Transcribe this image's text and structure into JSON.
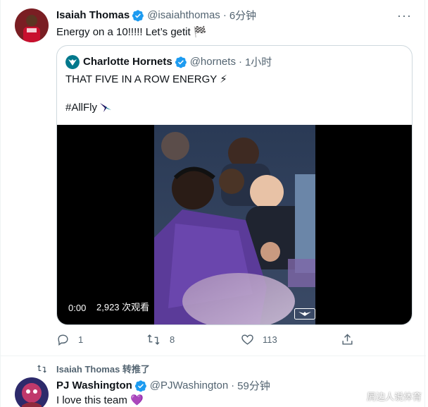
{
  "tweet1": {
    "name": "Isaiah Thomas",
    "handle": "@isaiahthomas",
    "separator": "·",
    "time": "6分钟",
    "text": "Energy on a 10!!!!! Let’s getit 🏁",
    "more": "···",
    "quote": {
      "name": "Charlotte Hornets",
      "handle": "@hornets",
      "separator": "·",
      "time": "1小时",
      "line1": "THAT FIVE IN A ROW ENERGY ⚡",
      "hashtag": "#AllFly",
      "video": {
        "time": "0:00",
        "views": "2,923 次观看"
      }
    },
    "actions": {
      "reply_count": "1",
      "retweet_count": "8",
      "like_count": "113"
    }
  },
  "retweet_banner": {
    "text": "Isaiah Thomas 转推了"
  },
  "tweet2": {
    "name": "PJ Washington",
    "handle": "@PJWashington",
    "separator": "·",
    "time": "59分钟",
    "text": "I love this team 💜"
  },
  "watermark": "屑边人说体育",
  "colors": {
    "verified": "#1d9bf0",
    "secondary_text": "#536471",
    "border": "#cfd9de",
    "hornets_teal": "#00788c",
    "hornets_purple": "#5b3b99"
  }
}
